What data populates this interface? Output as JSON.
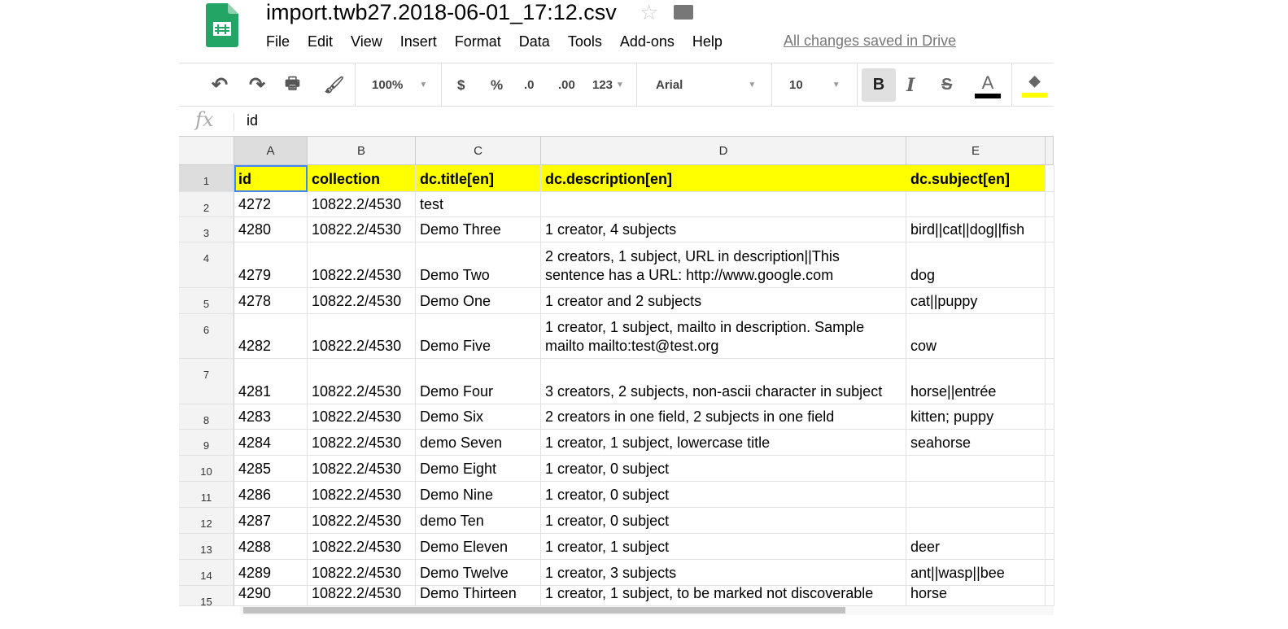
{
  "app": {
    "title": "import.twb27.2018-06-01_17:12.csv",
    "save_status": "All changes saved in Drive",
    "menu": [
      "File",
      "Edit",
      "View",
      "Insert",
      "Format",
      "Data",
      "Tools",
      "Add-ons",
      "Help"
    ]
  },
  "toolbar": {
    "zoom": "100%",
    "currency": "$",
    "percent": "%",
    "dec_decrease": ".0",
    "dec_increase": ".00",
    "more_formats": "123",
    "font": "Arial",
    "font_size": "10",
    "bold": "B",
    "italic": "I",
    "strike": "S",
    "text_color_label": "A",
    "text_color": "#000000",
    "fill_color": "#ffff00"
  },
  "formula_bar": {
    "fx": "fx",
    "value": "id"
  },
  "sheet": {
    "columns": [
      "A",
      "B",
      "C",
      "D",
      "E"
    ],
    "rows": [
      [
        "id",
        "collection",
        "dc.title[en]",
        "dc.description[en]",
        "dc.subject[en]"
      ],
      [
        "4272",
        "10822.2/4530",
        "test",
        "",
        ""
      ],
      [
        "4280",
        "10822.2/4530",
        "Demo Three",
        "1 creator, 4 subjects",
        "bird||cat||dog||fish"
      ],
      [
        "4279",
        "10822.2/4530",
        "Demo Two",
        "2 creators, 1 subject, URL in description||This sentence has a URL: http://www.google.com",
        "dog"
      ],
      [
        "4278",
        "10822.2/4530",
        "Demo One",
        "1 creator and 2 subjects",
        "cat||puppy"
      ],
      [
        "4282",
        "10822.2/4530",
        "Demo Five",
        "1 creator, 1 subject, mailto in description. Sample mailto mailto:test@test.org",
        "cow"
      ],
      [
        "4281",
        "10822.2/4530",
        "Demo Four",
        "3 creators, 2 subjects, non-ascii character in subject",
        "horse||entrée"
      ],
      [
        "4283",
        "10822.2/4530",
        "Demo Six",
        "2 creators in one field, 2 subjects in one field",
        "kitten; puppy"
      ],
      [
        "4284",
        "10822.2/4530",
        "demo Seven",
        "1 creator, 1 subject, lowercase title",
        "seahorse"
      ],
      [
        "4285",
        "10822.2/4530",
        "Demo Eight",
        "1 creator, 0 subject",
        ""
      ],
      [
        "4286",
        "10822.2/4530",
        "Demo Nine",
        "1 creator, 0 subject",
        ""
      ],
      [
        "4287",
        "10822.2/4530",
        "demo Ten",
        "1 creator, 0 subject",
        ""
      ],
      [
        "4288",
        "10822.2/4530",
        "Demo Eleven",
        "1 creator, 1 subject",
        "deer"
      ],
      [
        "4289",
        "10822.2/4530",
        "Demo Twelve",
        "1 creator, 3 subjects",
        "ant||wasp||bee"
      ],
      [
        "4290",
        "10822.2/4530",
        "Demo Thirteen",
        "1 creator, 1 subject, to be marked not discoverable",
        "horse"
      ]
    ],
    "row_numbers": [
      "1",
      "2",
      "3",
      "4",
      "5",
      "6",
      "7",
      "8",
      "9",
      "10",
      "11",
      "12",
      "13",
      "14",
      "15"
    ],
    "header_fill": "#ffff00",
    "selected_cell": "A1"
  }
}
